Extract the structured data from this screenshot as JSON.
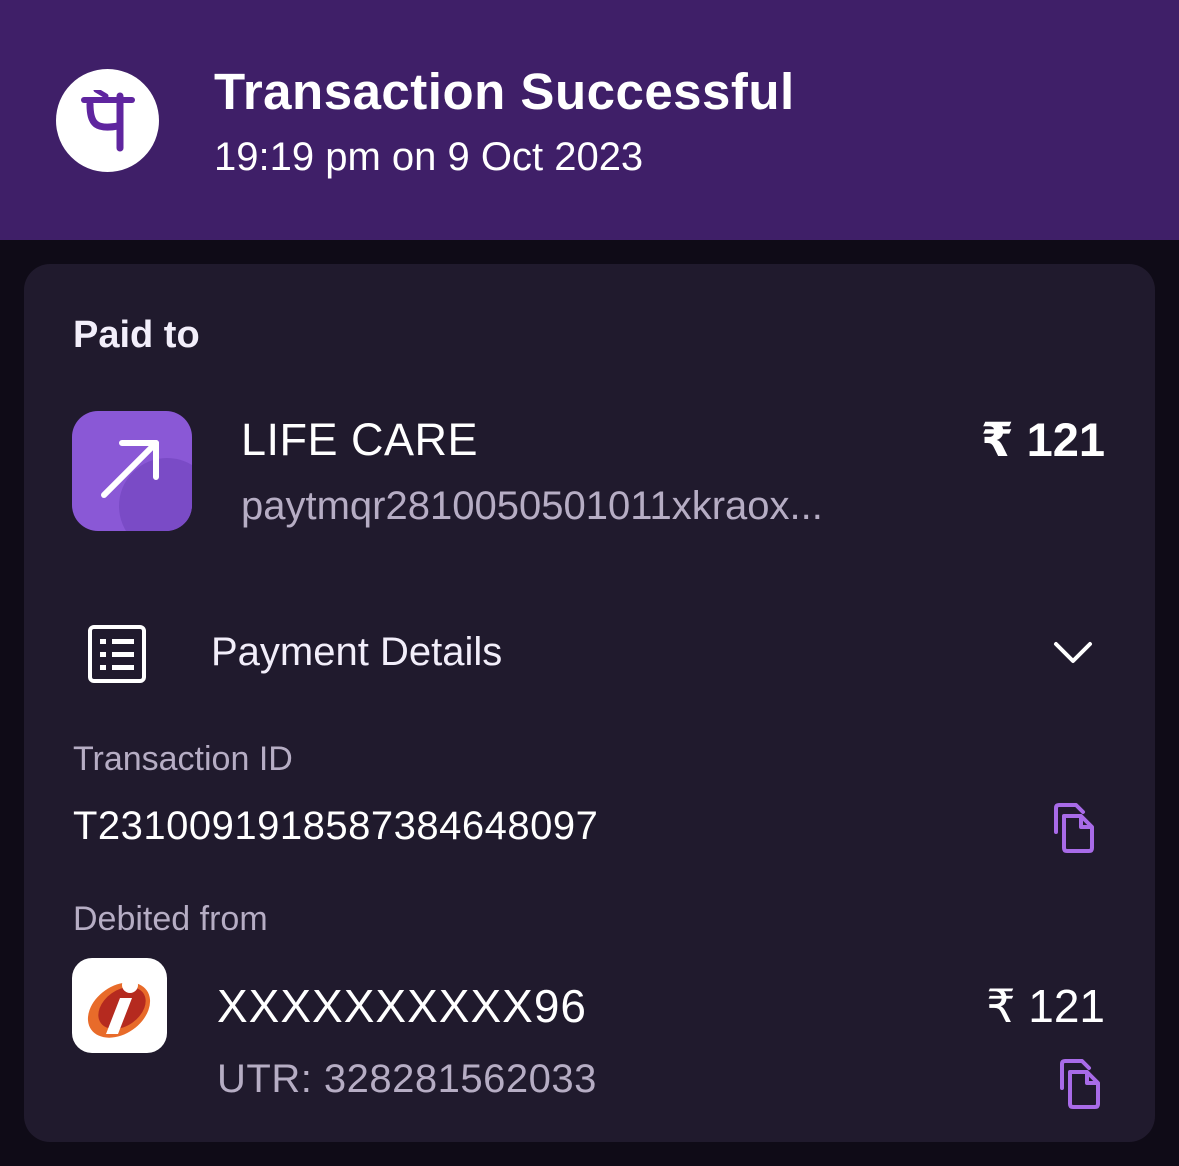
{
  "header": {
    "title": "Transaction Successful",
    "subtitle": "19:19 pm on 9 Oct 2023",
    "logo_glyph": "पे",
    "bg_color": "#3f1f68",
    "logo_icon": "phonepe-logo-icon"
  },
  "payee": {
    "section_label": "Paid to",
    "name": "LIFE CARE",
    "vpa": "paytmqr2810050501011xkraox...",
    "amount": "₹ 121",
    "icon": "arrow-up-right-icon"
  },
  "payment_details": {
    "label": "Payment Details",
    "icon": "receipt-list-icon",
    "toggle_icon": "chevron-down-icon",
    "transaction_id_label": "Transaction ID",
    "transaction_id": "T2310091918587384648097",
    "debited_from_label": "Debited from",
    "account": "XXXXXXXXXX96",
    "amount": "₹ 121",
    "utr": "UTR: 328281562033",
    "bank_icon": "icici-bank-logo-icon",
    "copy_icon": "copy-icon"
  },
  "colors": {
    "accent": "#a86be8",
    "card": "#201a2d",
    "page": "#0f0b17",
    "muted_text": "#b6adc4"
  }
}
